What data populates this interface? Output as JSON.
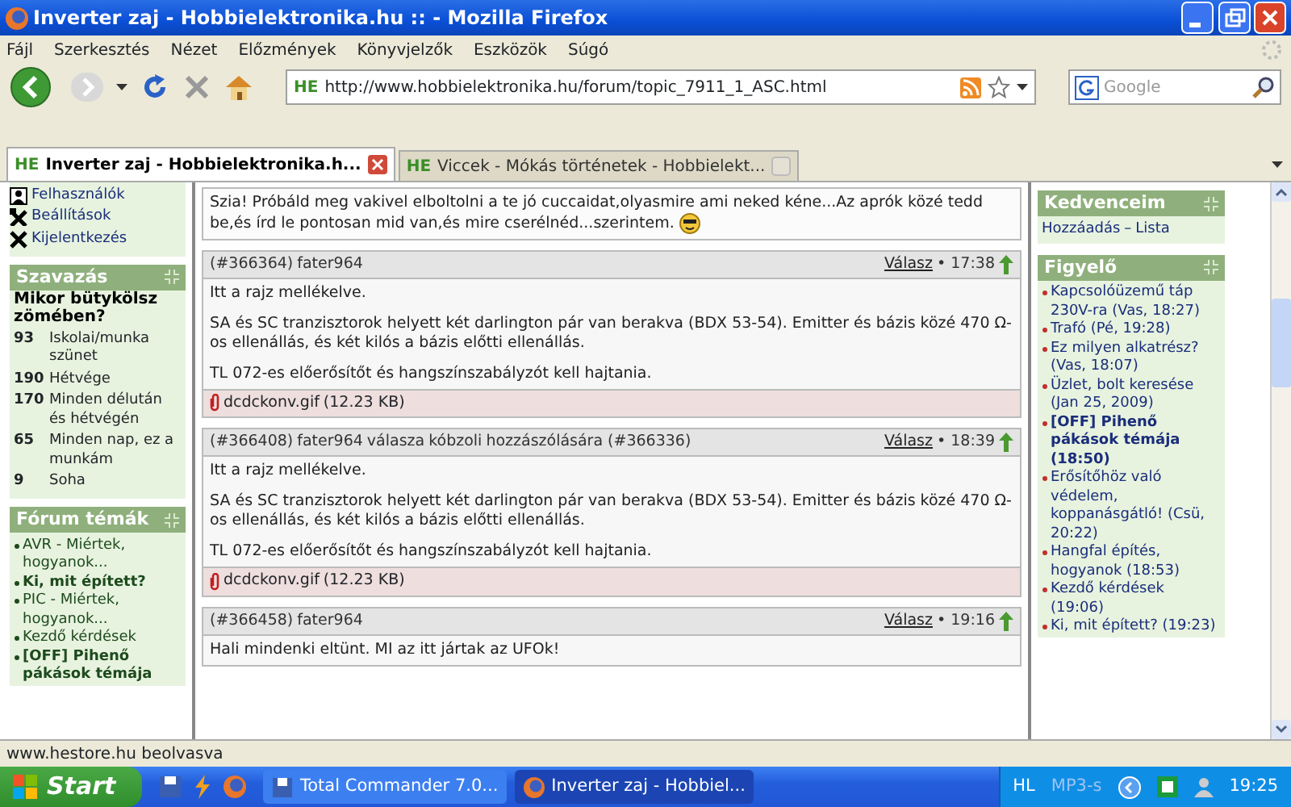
{
  "window": {
    "title": "Inverter zaj - Hobbielektronika.hu :: - Mozilla Firefox"
  },
  "menu": [
    "Fájl",
    "Szerkesztés",
    "Nézet",
    "Előzmények",
    "Könyvjelzők",
    "Eszközök",
    "Súgó"
  ],
  "toolbar": {
    "site_badge": "HE",
    "url": "http://www.hobbielektronika.hu/forum/topic_7911_1_ASC.html",
    "search_placeholder": "Google"
  },
  "tabs": [
    {
      "badge": "HE",
      "label": "Inverter zaj - Hobbielektronika.h...",
      "selected": true
    },
    {
      "badge": "HE",
      "label": "Viccek - Mókás történetek - Hobbielekt...",
      "selected": false
    }
  ],
  "sidebar": {
    "user_menu": [
      {
        "kind": "users",
        "label": "Felhasználók"
      },
      {
        "kind": "settings",
        "label": "Beállítások"
      },
      {
        "kind": "logout",
        "label": "Kijelentkezés"
      }
    ],
    "poll": {
      "title": "Szavazás",
      "question": "Mikor bütykölsz zömében?",
      "options": [
        {
          "count": "93",
          "label": "Iskolai/munka szünet"
        },
        {
          "count": "190",
          "label": "Hétvége"
        },
        {
          "count": "170",
          "label": "Minden délután és hétvégén"
        },
        {
          "count": "65",
          "label": "Minden nap, ez a munkám"
        },
        {
          "count": "9",
          "label": "Soha"
        }
      ]
    },
    "forum_topics": {
      "title": "Fórum témák",
      "items": [
        {
          "label": "AVR - Miértek, hogyanok...",
          "bold": false
        },
        {
          "label": "Ki, mit épített?",
          "bold": true
        },
        {
          "label": "PIC - Miértek, hogyanok...",
          "bold": false
        },
        {
          "label": "Kezdő kérdések",
          "bold": false
        },
        {
          "label": "[OFF] Pihenő pákások témája",
          "bold": true
        }
      ]
    }
  },
  "first_post_body": "Szia! Próbáld meg vakivel elboltolni a te jó cuccaidat,olyasmire ami neked kéne...Az aprók közé tedd be,és írd le pontosan mid van,és mire cserélnéd...szerintem.",
  "posts": [
    {
      "number": "(#366364)",
      "author": "fater964",
      "reply_label": "Válasz",
      "time": "• 17:38",
      "paragraphs": [
        "Itt a rajz mellékelve.",
        "SA és SC tranzisztorok helyett két darlington pár van berakva (BDX 53-54). Emitter és bázis közé 470 Ω-os ellenállás, és két kilós a bázis előtti ellenállás.",
        "TL 072-es előerősítőt és hangszínszabályzót kell hajtania."
      ],
      "attachment": {
        "file": "dcdckonv.gif",
        "size": "(12.23 KB)"
      }
    },
    {
      "number": "(#366408)",
      "author": "fater964",
      "reply": {
        "word": "válasza",
        "author": "kóbzoli",
        "suffix": "hozzászólására (#366336)"
      },
      "reply_label": "Válasz",
      "time": "• 18:39",
      "paragraphs": [
        "Itt a rajz mellékelve.",
        "SA és SC tranzisztorok helyett két darlington pár van berakva (BDX 53-54). Emitter és bázis közé 470 Ω-os ellenállás, és két kilós a bázis előtti ellenállás.",
        "TL 072-es előerősítőt és hangszínszabályzót kell hajtania."
      ],
      "attachment": {
        "file": "dcdckonv.gif",
        "size": "(12.23 KB)"
      }
    },
    {
      "number": "(#366458)",
      "author": "fater964",
      "reply_label": "Válasz",
      "time": "• 19:16",
      "paragraphs": [
        "Hali mindenki eltünt. MI az itt jártak az UFOk!"
      ]
    }
  ],
  "right": {
    "favorites": {
      "title": "Kedvenceim",
      "links": [
        "Hozzáadás",
        "Lista"
      ],
      "separator": "–"
    },
    "watch": {
      "title": "Figyelő",
      "items": [
        {
          "label": "Kapcsolóüzemű táp 230V-ra",
          "time": "(Vas, 18:27)",
          "bold": false
        },
        {
          "label": "Trafó",
          "time": "(Pé, 19:28)",
          "bold": false
        },
        {
          "label": "Ez milyen alkatrész?",
          "time": "(Vas, 18:07)",
          "bold": false
        },
        {
          "label": "Üzlet, bolt keresése",
          "time": "(Jan 25, 2009)",
          "bold": false
        },
        {
          "label": "[OFF] Pihenő pákások témája",
          "time": "(18:50)",
          "bold": true
        },
        {
          "label": "Erősítőhöz való védelem, koppanásgátló!",
          "time": "(Csü, 20:22)",
          "bold": false
        },
        {
          "label": "Hangfal építés, hogyanok",
          "time": "(18:53)",
          "bold": false
        },
        {
          "label": "Kezdő kérdések",
          "time": "(19:06)",
          "bold": false
        },
        {
          "label": "Ki, mit épített?",
          "time": "(19:23)",
          "bold": false
        }
      ]
    }
  },
  "status_bar": "www.hestore.hu beolvasva",
  "taskbar": {
    "start": "Start",
    "tasks": [
      {
        "label": "Total Commander 7.0...",
        "kind": "disk",
        "selected": false
      },
      {
        "label": "Inverter zaj - Hobbiel...",
        "kind": "browser",
        "selected": true
      }
    ],
    "tray": [
      "HL",
      "MP3-s"
    ],
    "clock": "19:25"
  }
}
